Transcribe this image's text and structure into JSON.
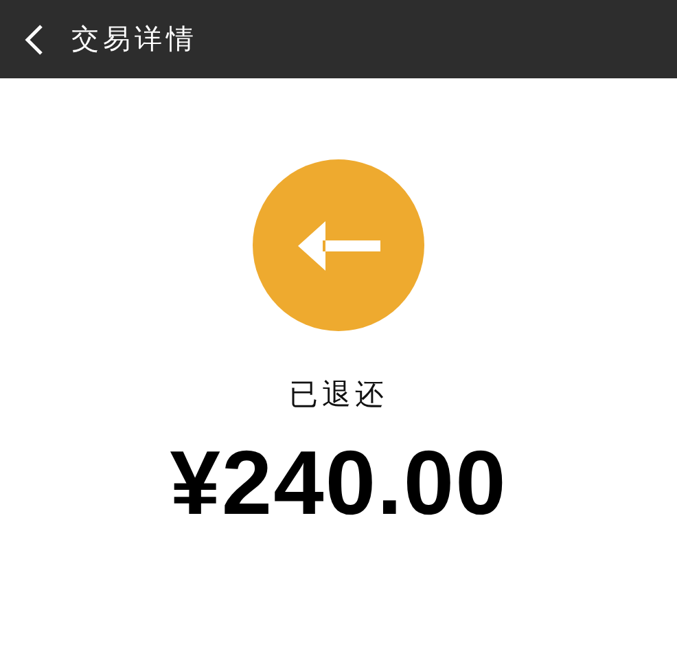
{
  "header": {
    "title": "交易详情"
  },
  "status": "已退还",
  "amount": "¥240.00"
}
